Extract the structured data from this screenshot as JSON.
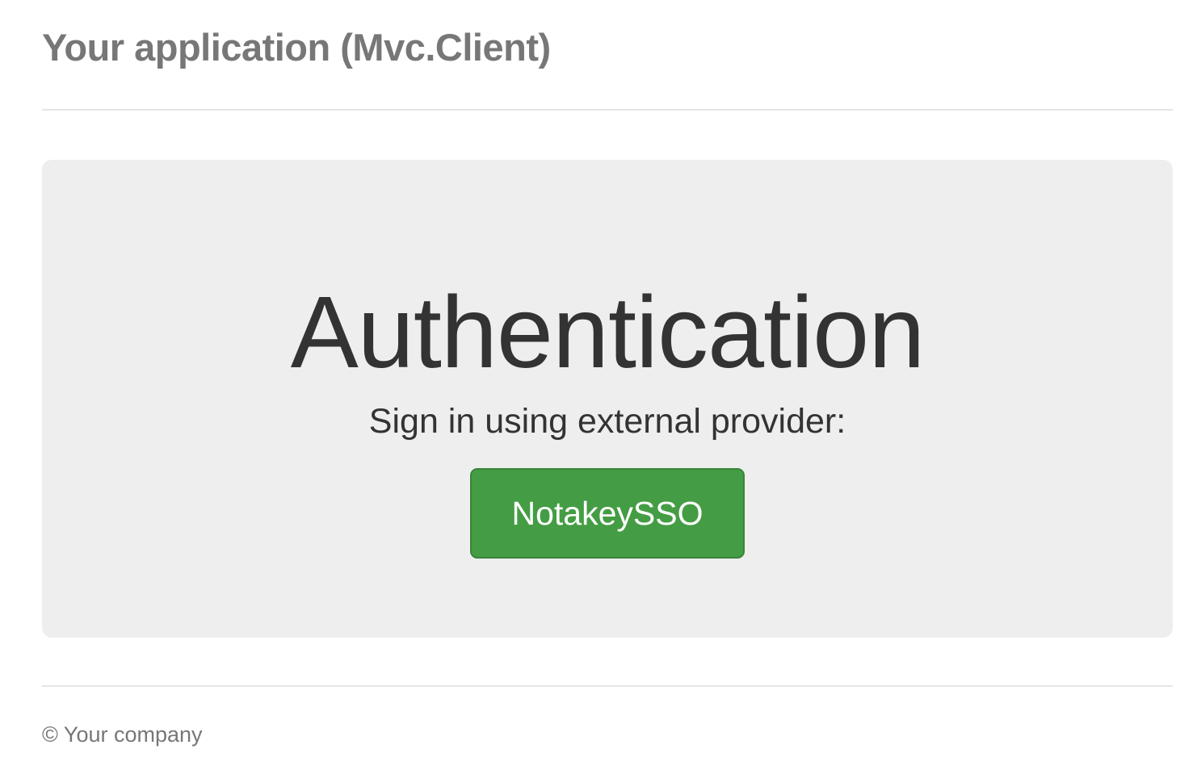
{
  "header": {
    "app_title": "Your application (Mvc.Client)"
  },
  "main": {
    "heading": "Authentication",
    "lead": "Sign in using external provider:",
    "providers": [
      {
        "label": "NotakeySSO"
      }
    ]
  },
  "footer": {
    "copyright": "© Your company"
  },
  "colors": {
    "title_text": "#777777",
    "body_text": "#333333",
    "jumbotron_bg": "#eeeeee",
    "button_bg": "#449d44",
    "button_border": "#398439",
    "button_text": "#ffffff",
    "divider": "#e5e5e5"
  }
}
